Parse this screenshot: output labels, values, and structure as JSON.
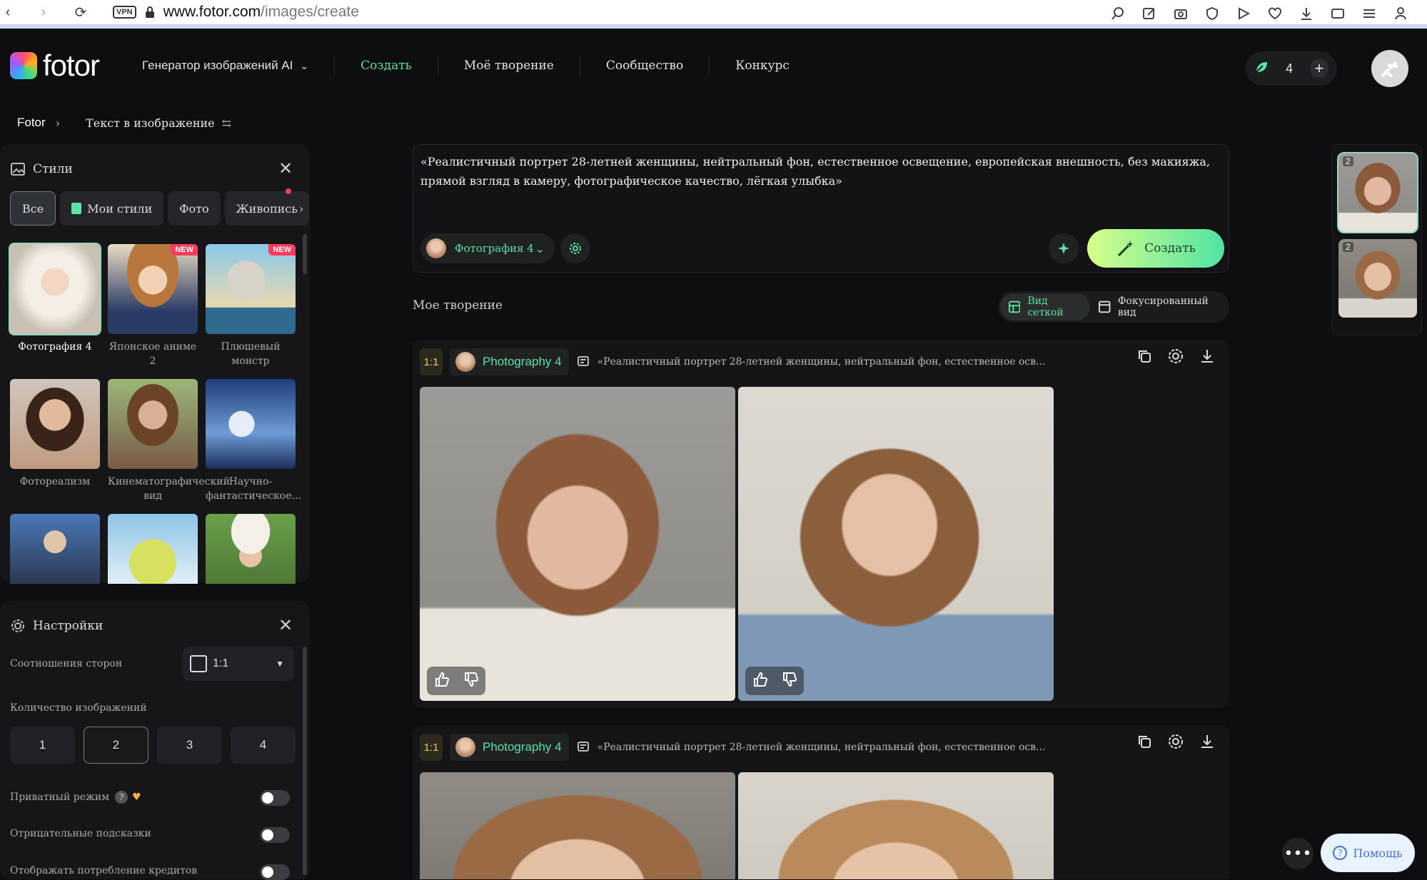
{
  "browser": {
    "vpn_label": "VPN",
    "url_host": "www.fotor.com",
    "url_path": "/images/create"
  },
  "header": {
    "logo_text": "fotor",
    "nav": [
      {
        "label": "Генератор изображений AI"
      },
      {
        "label": "Создать"
      },
      {
        "label": "Моё творение"
      },
      {
        "label": "Сообщество"
      },
      {
        "label": "Конкурс"
      }
    ],
    "credits": "4"
  },
  "breadcrumb": {
    "home": "Fotor",
    "current": "Текст в изображение"
  },
  "styles_panel": {
    "title": "Стили",
    "tabs": [
      "Все",
      "Мои стили",
      "Фото",
      "Живопись"
    ],
    "new_badge": "NEW",
    "items": [
      {
        "label": "Фотография 4",
        "selected": true,
        "new": false
      },
      {
        "label": "Японское аниме 2",
        "selected": false,
        "new": true
      },
      {
        "label": "Плюшевый монстр",
        "selected": false,
        "new": true
      },
      {
        "label": "Фотореализм",
        "selected": false,
        "new": false
      },
      {
        "label": "Кинематографический вид",
        "selected": false,
        "new": false
      },
      {
        "label": "Научно-фантастическое...",
        "selected": false,
        "new": false
      },
      {
        "label": "",
        "selected": false,
        "new": false
      },
      {
        "label": "",
        "selected": false,
        "new": false
      },
      {
        "label": "",
        "selected": false,
        "new": false
      }
    ]
  },
  "settings_panel": {
    "title": "Настройки",
    "aspect_label": "Соотношения сторон",
    "aspect_value": "1:1",
    "count_label": "Количество изображений",
    "counts": [
      "1",
      "2",
      "3",
      "4"
    ],
    "count_selected": "2",
    "private_label": "Приватный режим",
    "negative_label": "Отрицательные подсказки",
    "credits_label": "Отображать потребление кредитов"
  },
  "prompt": {
    "text": "«Реалистичный портрет 28-летней женщины, нейтральный фон, естественное освещение, европейская внешность, без макияжа, прямой взгляд в камеру, фотографическое качество, лёгкая улыбка»",
    "style": "Фотография 4",
    "create_label": "Создать"
  },
  "creations": {
    "title": "Мое творение",
    "grid_view": "Вид сеткой",
    "focus_view": "Фокусированный вид",
    "generations": [
      {
        "ratio": "1:1",
        "style": "Photography 4",
        "prompt": "«Реалистичный портрет 28-летней женщины, нейтральный фон, естественное осв..."
      },
      {
        "ratio": "1:1",
        "style": "Photography 4",
        "prompt": "«Реалистичный портрет 28-летней женщины, нейтральный фон, естественное осв..."
      }
    ]
  },
  "history": {
    "items": [
      {
        "count": "2"
      },
      {
        "count": "2"
      }
    ]
  },
  "help_label": "Помощь",
  "colors": {
    "accent": "#5ee0a6",
    "background": "#0e0e10"
  }
}
